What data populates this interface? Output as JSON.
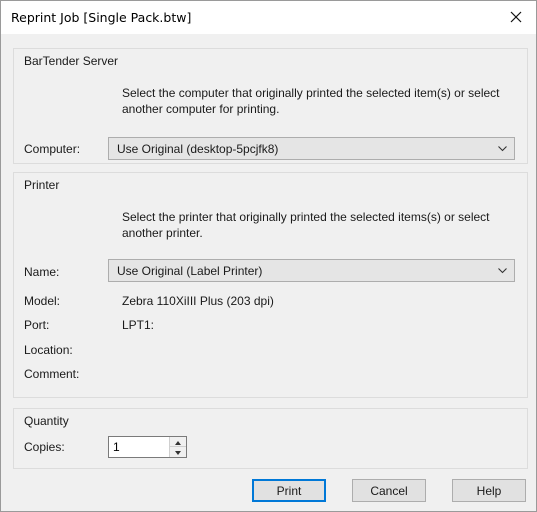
{
  "window": {
    "title": "Reprint Job [Single Pack.btw]"
  },
  "server_group": {
    "label": "BarTender Server",
    "hint": "Select the computer that originally printed the selected item(s) or select another computer for printing.",
    "computer_label": "Computer:",
    "computer_value": "Use Original (desktop-5pcjfk8)"
  },
  "printer_group": {
    "label": "Printer",
    "hint": "Select the printer that originally printed the selected items(s) or select another printer.",
    "name_label": "Name:",
    "name_value": "Use Original (Label Printer)",
    "model_label": "Model:",
    "model_value": "Zebra 110XiIII Plus (203 dpi)",
    "port_label": "Port:",
    "port_value": "LPT1:",
    "location_label": "Location:",
    "comment_label": "Comment:"
  },
  "quantity_group": {
    "label": "Quantity",
    "copies_label": "Copies:",
    "copies_value": "1"
  },
  "buttons": {
    "print": "Print",
    "cancel": "Cancel",
    "help": "Help"
  },
  "icons": {
    "close": "close-icon",
    "dropdown": "chevron-down-icon",
    "spin_up": "arrow-up-icon",
    "spin_down": "arrow-down-icon"
  },
  "colors": {
    "default_button_border": "#0078d7",
    "dialog_background": "#f0f0f0"
  }
}
